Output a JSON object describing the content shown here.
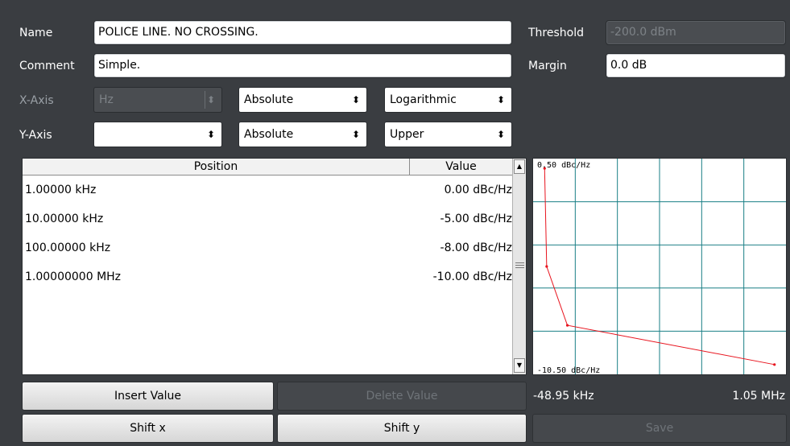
{
  "form": {
    "name_label": "Name",
    "name_value": "POLICE LINE. NO CROSSING.",
    "comment_label": "Comment",
    "comment_value": "Simple.",
    "threshold_label": "Threshold",
    "threshold_value": "-200.0 dBm",
    "margin_label": "Margin",
    "margin_value": "0.0 dB",
    "xaxis_label": "X-Axis",
    "xaxis_unit": "Hz",
    "xaxis_scaling": "Absolute",
    "xaxis_spacing": "Logarithmic",
    "yaxis_label": "Y-Axis",
    "yaxis_unit": "",
    "yaxis_scaling": "Absolute",
    "yaxis_type": "Upper"
  },
  "table": {
    "col_position": "Position",
    "col_value": "Value",
    "rows": [
      {
        "position": "1.00000 kHz",
        "value": "0.00 dBc/Hz"
      },
      {
        "position": "10.00000 kHz",
        "value": "-5.00 dBc/Hz"
      },
      {
        "position": "100.00000 kHz",
        "value": "-8.00 dBc/Hz"
      },
      {
        "position": "1.00000000 MHz",
        "value": "-10.00 dBc/Hz"
      }
    ]
  },
  "graph": {
    "y_top_label": "0.50 dBc/Hz",
    "y_bottom_label": "-10.50 dBc/Hz",
    "x_left_label": "-48.95 kHz",
    "x_right_label": "1.05 MHz"
  },
  "chart_data": {
    "type": "line",
    "x": [
      1000,
      10000,
      100000,
      1000000
    ],
    "y": [
      0.0,
      -5.0,
      -8.0,
      -10.0
    ],
    "xlim": [
      -48950,
      1050000
    ],
    "ylim": [
      -10.5,
      0.5
    ],
    "grid": true,
    "line_color": "#e8141e"
  },
  "buttons": {
    "insert_value": "Insert Value",
    "delete_value": "Delete Value",
    "shift_x": "Shift x",
    "shift_y": "Shift y",
    "save": "Save"
  },
  "icons": {
    "combo_arrow": "updown-arrow-icon",
    "scroll_up": "scroll-up-icon",
    "scroll_down": "scroll-down-icon",
    "scroll_grip": "scroll-grip-icon"
  }
}
